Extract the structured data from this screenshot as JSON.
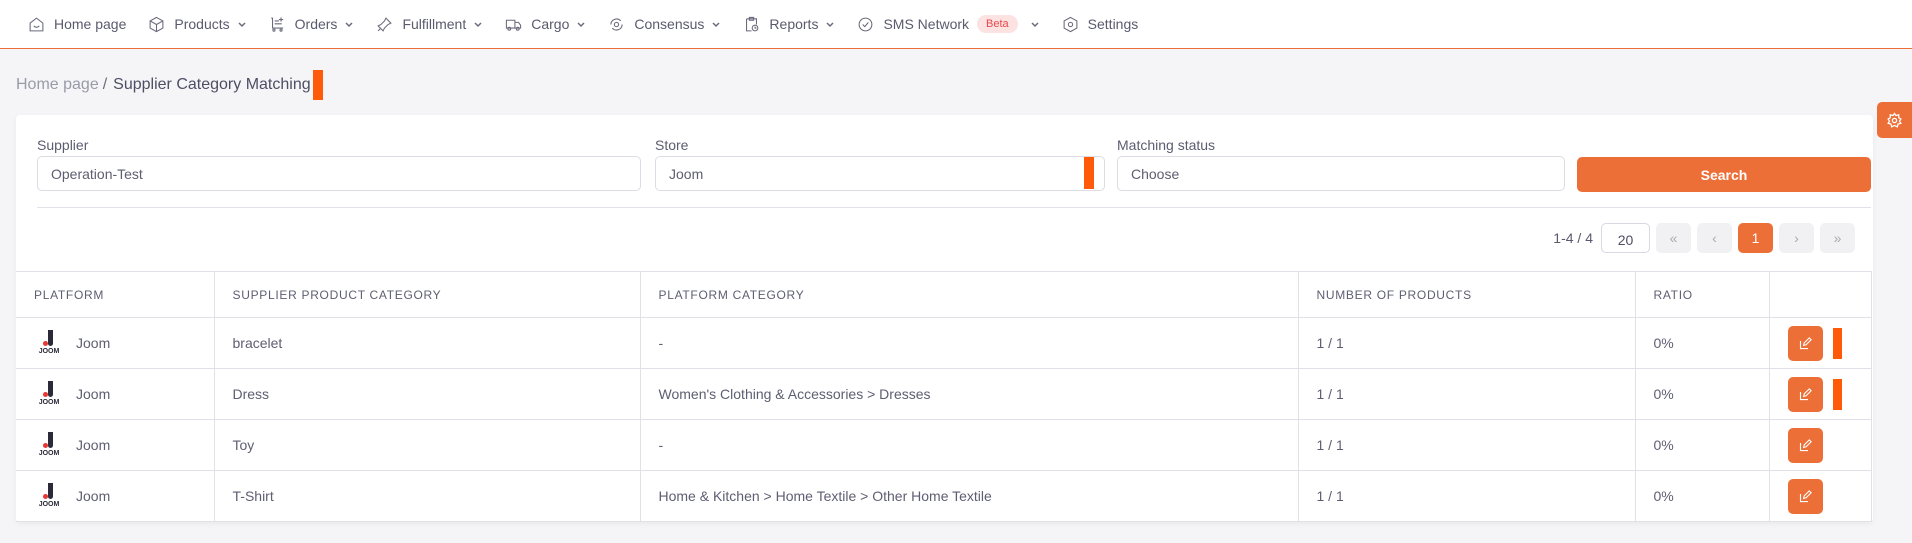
{
  "nav": {
    "items": [
      {
        "label": "Home page",
        "icon": "home-icon",
        "dropdown": false
      },
      {
        "label": "Products",
        "icon": "box-icon",
        "dropdown": true
      },
      {
        "label": "Orders",
        "icon": "cart-icon",
        "dropdown": true
      },
      {
        "label": "Fulfillment",
        "icon": "pin-icon",
        "dropdown": true
      },
      {
        "label": "Cargo",
        "icon": "truck-icon",
        "dropdown": true
      },
      {
        "label": "Consensus",
        "icon": "sync-icon",
        "dropdown": true
      },
      {
        "label": "Reports",
        "icon": "report-icon",
        "dropdown": true
      },
      {
        "label": "SMS Network",
        "icon": "check-circle-icon",
        "dropdown": true,
        "badge": "Beta"
      },
      {
        "label": "Settings",
        "icon": "settings-icon",
        "dropdown": false
      }
    ]
  },
  "breadcrumb": {
    "home": "Home page",
    "separator": "/",
    "current": "Supplier Category Matching"
  },
  "filters": {
    "supplier": {
      "label": "Supplier",
      "value": "Operation-Test"
    },
    "store": {
      "label": "Store",
      "value": "Joom"
    },
    "matching_status": {
      "label": "Matching status",
      "value": "Choose"
    },
    "search_label": "Search"
  },
  "pagination": {
    "range": "1-4 / 4",
    "page_size": "20",
    "first": "«",
    "prev": "‹",
    "current": "1",
    "next": "›",
    "last": "»"
  },
  "table": {
    "columns": [
      "PLATFORM",
      "SUPPLIER PRODUCT CATEGORY",
      "PLATFORM CATEGORY",
      "NUMBER OF PRODUCTS",
      "RATIO",
      ""
    ],
    "rows": [
      {
        "platform": "Joom",
        "logo_text": "JOOM",
        "supplier_category": "bracelet",
        "platform_category": "-",
        "products": "1 / 1",
        "ratio": "0%"
      },
      {
        "platform": "Joom",
        "logo_text": "JOOM",
        "supplier_category": "Dress",
        "platform_category": "Women's Clothing & Accessories > Dresses",
        "products": "1 / 1",
        "ratio": "0%"
      },
      {
        "platform": "Joom",
        "logo_text": "JOOM",
        "supplier_category": "Toy",
        "platform_category": "-",
        "products": "1 / 1",
        "ratio": "0%"
      },
      {
        "platform": "Joom",
        "logo_text": "JOOM",
        "supplier_category": "T-Shirt",
        "platform_category": "Home & Kitchen > Home Textile > Other Home Textile",
        "products": "1 / 1",
        "ratio": "0%"
      }
    ]
  },
  "colors": {
    "accent": "#ec6f37",
    "marker": "#ff5a0a",
    "beta_bg": "#fde2e2",
    "beta_text": "#e5484d"
  }
}
